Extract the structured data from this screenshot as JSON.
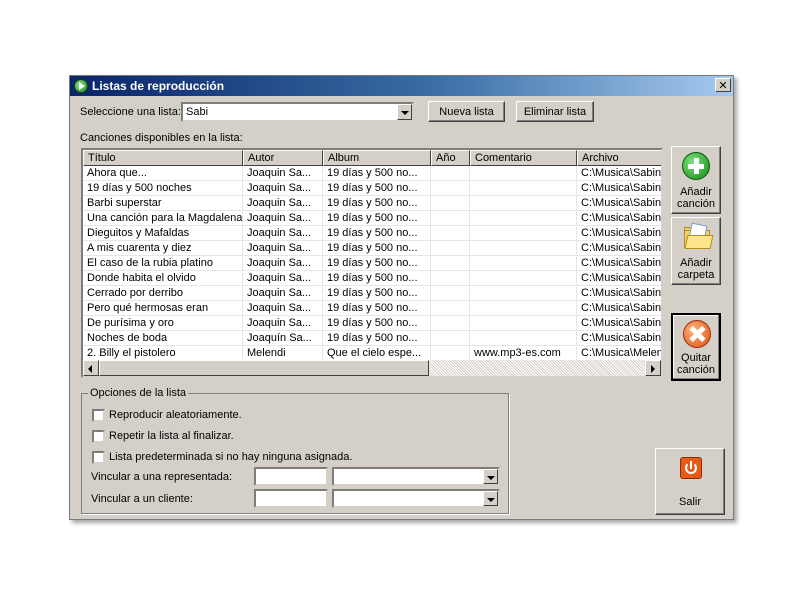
{
  "window": {
    "title": "Listas de reproducción",
    "close_glyph": "✕"
  },
  "selector": {
    "label": "Seleccione una lista:",
    "value": "Sabi"
  },
  "buttons": {
    "new_list": "Nueva lista",
    "delete_list": "Eliminar lista",
    "exit": "Salir"
  },
  "songs": {
    "label": "Canciones disponibles en la lista:",
    "columns": [
      "Título",
      "Autor",
      "Album",
      "Año",
      "Comentario",
      "Archivo"
    ],
    "rows": [
      [
        "Ahora que...",
        "Joaquin Sa...",
        "19 días y 500 no...",
        "",
        "",
        "C:\\Musica\\Sabina"
      ],
      [
        "19 días y 500 noches",
        "Joaquin Sa...",
        "19 días y 500 no...",
        "",
        "",
        "C:\\Musica\\Sabina"
      ],
      [
        "Barbi superstar",
        "Joaquin Sa...",
        "19 días y 500 no...",
        "",
        "",
        "C:\\Musica\\Sabina"
      ],
      [
        "Una canción para la Magdalena",
        "Joaquin Sa...",
        "19 días y 500 no...",
        "",
        "",
        "C:\\Musica\\Sabina"
      ],
      [
        "Dieguitos y Mafaldas",
        "Joaquin Sa...",
        "19 días y 500 no...",
        "",
        "",
        "C:\\Musica\\Sabina"
      ],
      [
        "A mis cuarenta y diez",
        "Joaquin Sa...",
        "19 días y 500 no...",
        "",
        "",
        "C:\\Musica\\Sabina"
      ],
      [
        "El caso de la rubia platino",
        "Joaquin Sa...",
        "19 días y 500 no...",
        "",
        "",
        "C:\\Musica\\Sabina"
      ],
      [
        "Donde habita el olvido",
        "Joaquin Sa...",
        "19 días y 500 no...",
        "",
        "",
        "C:\\Musica\\Sabina"
      ],
      [
        "Cerrado por derribo",
        "Joaquin Sa...",
        "19 días y 500 no...",
        "",
        "",
        "C:\\Musica\\Sabina"
      ],
      [
        "Pero qué hermosas eran",
        "Joaquin Sa...",
        "19 días y 500 no...",
        "",
        "",
        "C:\\Musica\\Sabina"
      ],
      [
        "De purísima y oro",
        "Joaquin Sa...",
        "19 días y 500 no...",
        "",
        "",
        "C:\\Musica\\Sabina"
      ],
      [
        "Noches de boda",
        "Joaquín Sa...",
        "19 días y 500 no...",
        "",
        "",
        "C:\\Musica\\Sabina"
      ],
      [
        "2. Billy el pistolero",
        "Melendi",
        "Que el cielo espe...",
        "",
        "www.mp3-es.com",
        "C:\\Musica\\Melendi"
      ]
    ]
  },
  "side_buttons": {
    "add_song": [
      "Añadir",
      "canción"
    ],
    "add_folder": [
      "Añadir",
      "carpeta"
    ],
    "remove_song": [
      "Quitar",
      "canción"
    ]
  },
  "options": {
    "title": "Opciones de la lista",
    "shuffle": "Reproducir aleatoriamente.",
    "repeat": "Repetir la lista al finalizar.",
    "default": "Lista predeterminada si no hay ninguna asignada.",
    "link_rep": "Vincular a una representada:",
    "link_client": "Vincular a un cliente:",
    "rep_code": "",
    "rep_name": "",
    "client_code": "",
    "client_name": ""
  }
}
